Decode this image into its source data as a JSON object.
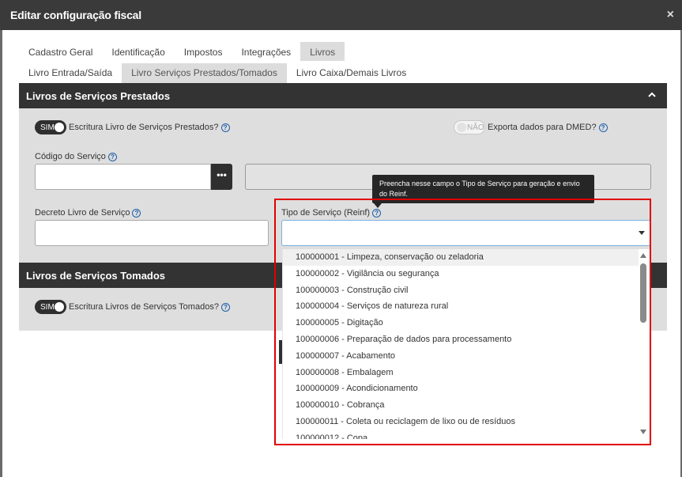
{
  "modal": {
    "title": "Editar configuração fiscal",
    "close_label": "×"
  },
  "tabs_primary": [
    {
      "label": "Cadastro Geral",
      "active": false
    },
    {
      "label": "Identificação",
      "active": false
    },
    {
      "label": "Impostos",
      "active": false
    },
    {
      "label": "Integrações",
      "active": false
    },
    {
      "label": "Livros",
      "active": true
    }
  ],
  "tabs_secondary": [
    {
      "label": "Livro Entrada/Saída",
      "active": false
    },
    {
      "label": "Livro Serviços Prestados/Tomados",
      "active": true
    },
    {
      "label": "Livro Caixa/Demais Livros",
      "active": false
    }
  ],
  "prestados": {
    "title": "Livros de Serviços Prestados",
    "toggle_escritura": {
      "state": "SIM",
      "label": "Escritura Livro de Serviços Prestados?"
    },
    "toggle_dmed": {
      "state": "NÃO",
      "label": "Exporta dados para DMED?"
    },
    "codigo_label": "Código do Serviço",
    "codigo_button": "•••",
    "decreto_label": "Decreto Livro de Serviço",
    "tipo_label": "Tipo de Serviço (Reinf)"
  },
  "tomados": {
    "title": "Livros de Serviços Tomados",
    "toggle_escritura": {
      "state": "SIM",
      "label": "Escritura Livros de Serviços Tomados?"
    }
  },
  "help_icon": "?",
  "tooltip": "Preencha nesse campo o Tipo de Serviço para geração e envio do Reinf.",
  "dropdown_options": [
    "100000001 - Limpeza, conservação ou zeladoria",
    "100000002 - Vigilância ou segurança",
    "100000003 - Construção civil",
    "100000004 - Serviços de natureza rural",
    "100000005 - Digitação",
    "100000006 - Preparação de dados para processamento",
    "100000007 - Acabamento",
    "100000008 - Embalagem",
    "100000009 - Acondicionamento",
    "100000010 - Cobrança",
    "100000011 - Coleta ou reciclagem de lixo ou de resíduos",
    "100000012 - Copa"
  ],
  "colors": {
    "header": "#3a3a3a",
    "section": "#333333",
    "panel": "#dedede",
    "highlight": "#e00000",
    "help": "#1d5fa8"
  }
}
